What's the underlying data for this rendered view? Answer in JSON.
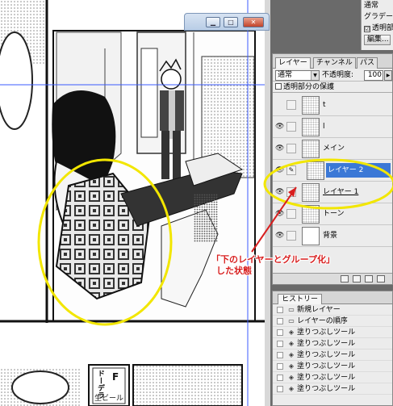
{
  "tool_panel": {
    "item1": "通常",
    "item2": "グラデー",
    "item3": "透明部",
    "item4_checked": "☑",
    "edit_button": "編集..."
  },
  "layer_panel": {
    "tabs": [
      "レイヤー",
      "チャンネル",
      "パス"
    ],
    "blend_mode": "通常",
    "opacity_label": "不透明度:",
    "opacity_value": "100",
    "protect_label": "透明部分の保護",
    "layers": [
      {
        "name": "t",
        "visible": false,
        "selected": false
      },
      {
        "name": "l",
        "visible": true,
        "selected": false
      },
      {
        "name": "メイン",
        "visible": true,
        "selected": false
      },
      {
        "name": "レイヤー 2",
        "visible": true,
        "selected": true
      },
      {
        "name": "レイヤー 1",
        "visible": true,
        "selected": false
      },
      {
        "name": "トーン",
        "visible": true,
        "selected": false
      },
      {
        "name": "背景",
        "visible": true,
        "selected": false
      }
    ]
  },
  "history_panel": {
    "tab": "ヒストリー",
    "items": [
      "新規レイヤー",
      "レイヤーの順序",
      "塗りつぶしツール",
      "塗りつぶしツール",
      "塗りつぶしツール",
      "塗りつぶしツール",
      "塗りつぶしツール",
      "塗りつぶしツール"
    ]
  },
  "annotation": {
    "line1": "「下のレイヤーとグループ化」",
    "line2": "した状態",
    "color": "#d81f1f",
    "highlight_color": "#f2e600"
  },
  "canvas": {
    "sign_text": "ドーデラ",
    "sign_text2": "生ビール",
    "mug_text": "F"
  },
  "icons": {
    "eye": "eye-icon",
    "brush": "brush-icon",
    "history_step": "paint-bucket-icon"
  }
}
